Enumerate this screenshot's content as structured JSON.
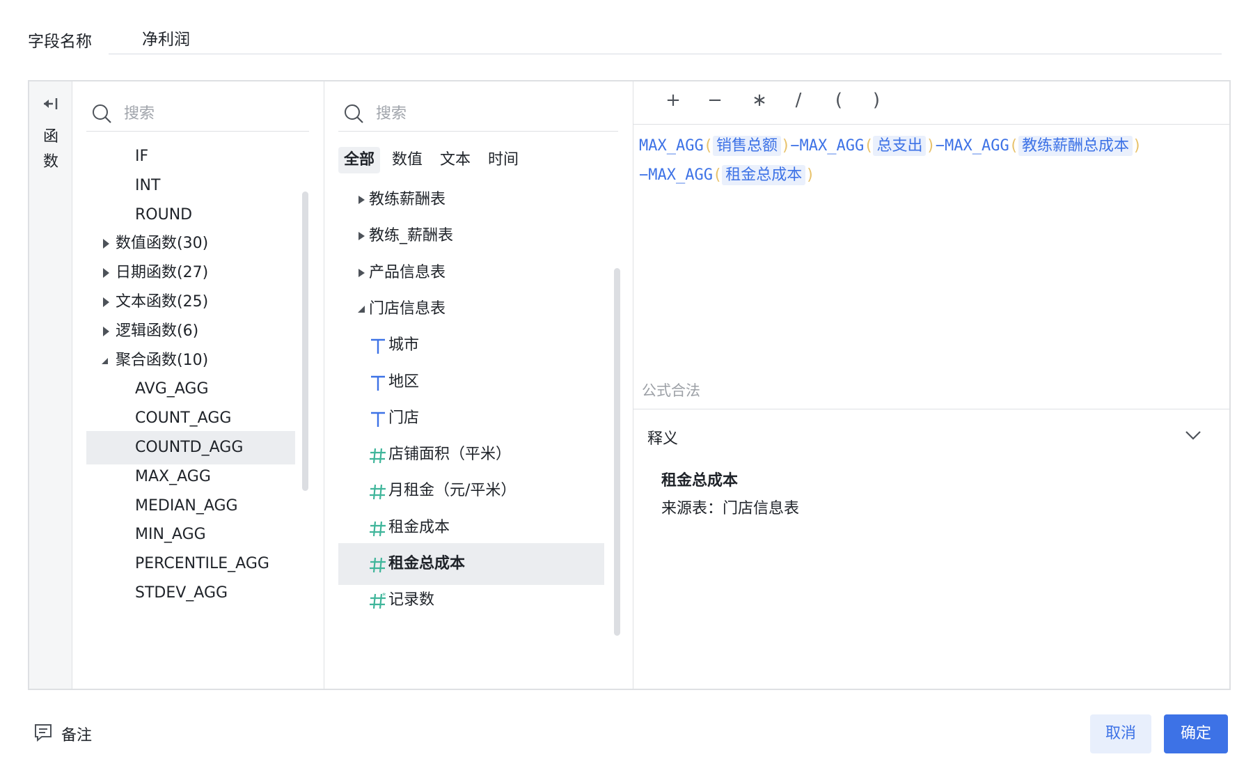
{
  "field_name": {
    "label": "字段名称",
    "value": "净利润"
  },
  "fn_panel": {
    "tab_label": "函数",
    "search_placeholder": "搜索",
    "items": [
      {
        "label": "IF",
        "kind": "fn"
      },
      {
        "label": "INT",
        "kind": "fn"
      },
      {
        "label": "ROUND",
        "kind": "fn"
      },
      {
        "label": "数值函数(30)",
        "kind": "group-collapsed"
      },
      {
        "label": "日期函数(27)",
        "kind": "group-collapsed"
      },
      {
        "label": "文本函数(25)",
        "kind": "group-collapsed"
      },
      {
        "label": "逻辑函数(6)",
        "kind": "group-collapsed"
      },
      {
        "label": "聚合函数(10)",
        "kind": "group-expanded"
      },
      {
        "label": "AVG_AGG",
        "kind": "fn"
      },
      {
        "label": "COUNT_AGG",
        "kind": "fn"
      },
      {
        "label": "COUNTD_AGG",
        "kind": "fn",
        "selected": true
      },
      {
        "label": "MAX_AGG",
        "kind": "fn"
      },
      {
        "label": "MEDIAN_AGG",
        "kind": "fn"
      },
      {
        "label": "MIN_AGG",
        "kind": "fn"
      },
      {
        "label": "PERCENTILE_AGG",
        "kind": "fn"
      },
      {
        "label": "STDEV_AGG",
        "kind": "fn"
      }
    ]
  },
  "field_panel": {
    "search_placeholder": "搜索",
    "tabs": [
      "全部",
      "数值",
      "文本",
      "时间"
    ],
    "active_tab": "全部",
    "items": [
      {
        "label": "教练薪酬表",
        "kind": "table-collapsed"
      },
      {
        "label": "教练_薪酬表",
        "kind": "table-collapsed"
      },
      {
        "label": "产品信息表",
        "kind": "table-collapsed"
      },
      {
        "label": "门店信息表",
        "kind": "table-expanded"
      },
      {
        "label": "城市",
        "kind": "text-field"
      },
      {
        "label": "地区",
        "kind": "text-field"
      },
      {
        "label": "门店",
        "kind": "text-field"
      },
      {
        "label": "店铺面积（平米）",
        "kind": "num-field"
      },
      {
        "label": "月租金（元/平米）",
        "kind": "num-field"
      },
      {
        "label": "租金成本",
        "kind": "num-field"
      },
      {
        "label": "租金总成本",
        "kind": "num-field",
        "selected": true
      },
      {
        "label": "记录数",
        "kind": "count-field"
      }
    ]
  },
  "formula_panel": {
    "operators": [
      "+",
      "−",
      "∗",
      "/",
      "(",
      ")"
    ],
    "formula": {
      "fn": "MAX_AGG",
      "paren_open": "(",
      "paren_close": ")",
      "minus": "−",
      "fields": [
        "销售总额",
        "总支出",
        "教练薪酬总成本",
        "租金总成本"
      ]
    },
    "valid_text": "公式合法",
    "explain": {
      "title": "释义",
      "name": "租金总成本",
      "source": "来源表：门店信息表"
    }
  },
  "footer": {
    "note_label": "备注",
    "cancel_label": "取消",
    "ok_label": "确定"
  },
  "colors": {
    "accent": "#3d72e6",
    "num_icon": "#3fb59a",
    "text_icon": "#3d72e6",
    "paren": "#e8c26b"
  }
}
